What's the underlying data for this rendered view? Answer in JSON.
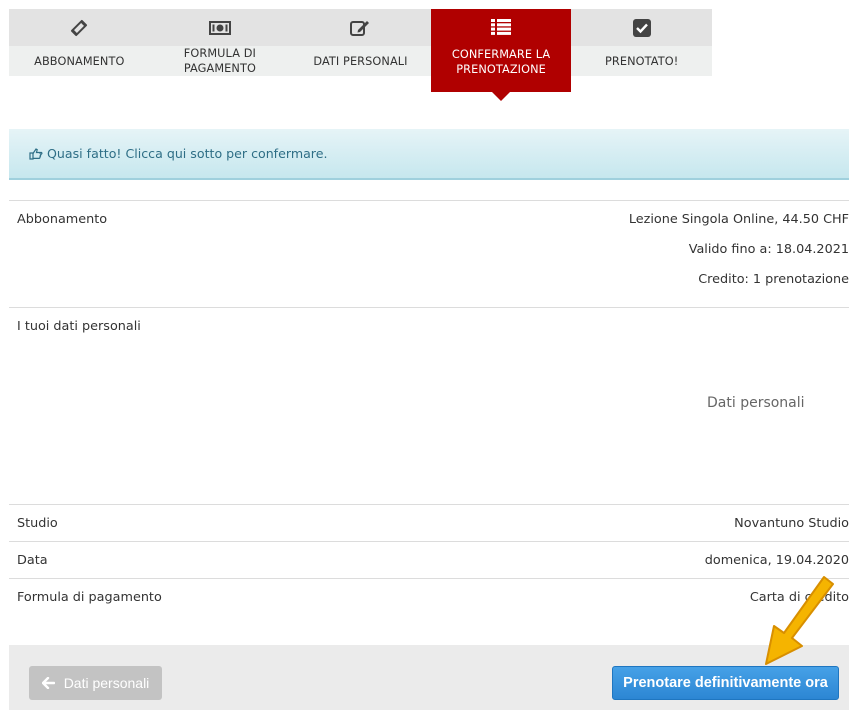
{
  "steps": [
    {
      "label": "ABBONAMENTO",
      "icon": "ticket-icon"
    },
    {
      "label": "FORMULA DI PAGAMENTO",
      "icon": "banknote-icon"
    },
    {
      "label": "DATI PERSONALI",
      "icon": "edit-icon"
    },
    {
      "label": "CONFERMARE LA PRENOTAZIONE",
      "icon": "list-icon",
      "active": true
    },
    {
      "label": "PRENOTATO!",
      "icon": "checkbox-icon"
    }
  ],
  "alert": {
    "icon": "hand-pointing-icon",
    "text": "Quasi fatto! Clicca qui sotto per confermare."
  },
  "summary": {
    "abbonamento_label": "Abbonamento",
    "abbonamento_name": "Lezione Singola Online, 44.50 CHF",
    "abbonamento_valid": "Valido fino a: 18.04.2021",
    "abbonamento_credit": "Credito: 1 prenotazione",
    "personal_label": "I tuoi dati personali",
    "personal_value": "Dati personali",
    "studio_label": "Studio",
    "studio_value": "Novantuno Studio",
    "data_label": "Data",
    "data_value": "domenica, 19.04.2020",
    "payment_label": "Formula di pagamento",
    "payment_value": "Carta di credito"
  },
  "footer": {
    "back_label": "Dati personali",
    "confirm_label": "Prenotare definitivamente ora"
  },
  "colors": {
    "active_step": "#b00000",
    "alert_text": "#2e6e86",
    "confirm_button": "#2c86d3",
    "annotation_arrow": "#f5b400"
  }
}
